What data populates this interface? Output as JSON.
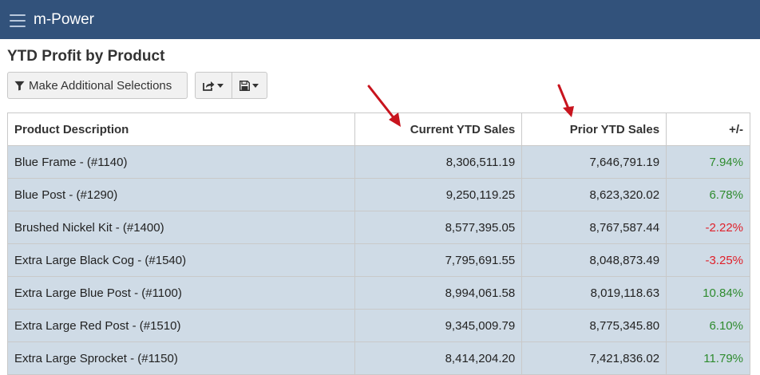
{
  "navbar": {
    "brand": "m-Power",
    "menu_icon": "hamburger-icon"
  },
  "page": {
    "title": "YTD Profit by Product"
  },
  "toolbar": {
    "select_label": "Make Additional Selections",
    "select_icon": "filter-icon",
    "share_icon": "share-icon",
    "save_icon": "save-icon"
  },
  "table": {
    "headers": [
      "Product Description",
      "Current YTD Sales",
      "Prior YTD Sales",
      "+/-"
    ],
    "rows": [
      [
        "Blue Frame - (#1140)",
        "8,306,511.19",
        "7,646,791.19",
        "7.94%"
      ],
      [
        "Blue Post - (#1290)",
        "9,250,119.25",
        "8,623,320.02",
        "6.78%"
      ],
      [
        "Brushed Nickel Kit - (#1400)",
        "8,577,395.05",
        "8,767,587.44",
        "-2.22%"
      ],
      [
        "Extra Large Black Cog - (#1540)",
        "7,795,691.55",
        "8,048,873.49",
        "-3.25%"
      ],
      [
        "Extra Large Blue Post - (#1100)",
        "8,994,061.58",
        "8,019,118.63",
        "10.84%"
      ],
      [
        "Extra Large Red Post - (#1510)",
        "9,345,009.79",
        "8,775,345.80",
        "6.10%"
      ],
      [
        "Extra Large Sprocket - (#1150)",
        "8,414,204.20",
        "7,421,836.02",
        "11.79%"
      ]
    ]
  },
  "colors": {
    "navbar": "#32527b",
    "row_bg": "#cfdbe6",
    "positive": "#2e8b2e",
    "negative": "#e0202a",
    "arrow": "#c8141e"
  }
}
